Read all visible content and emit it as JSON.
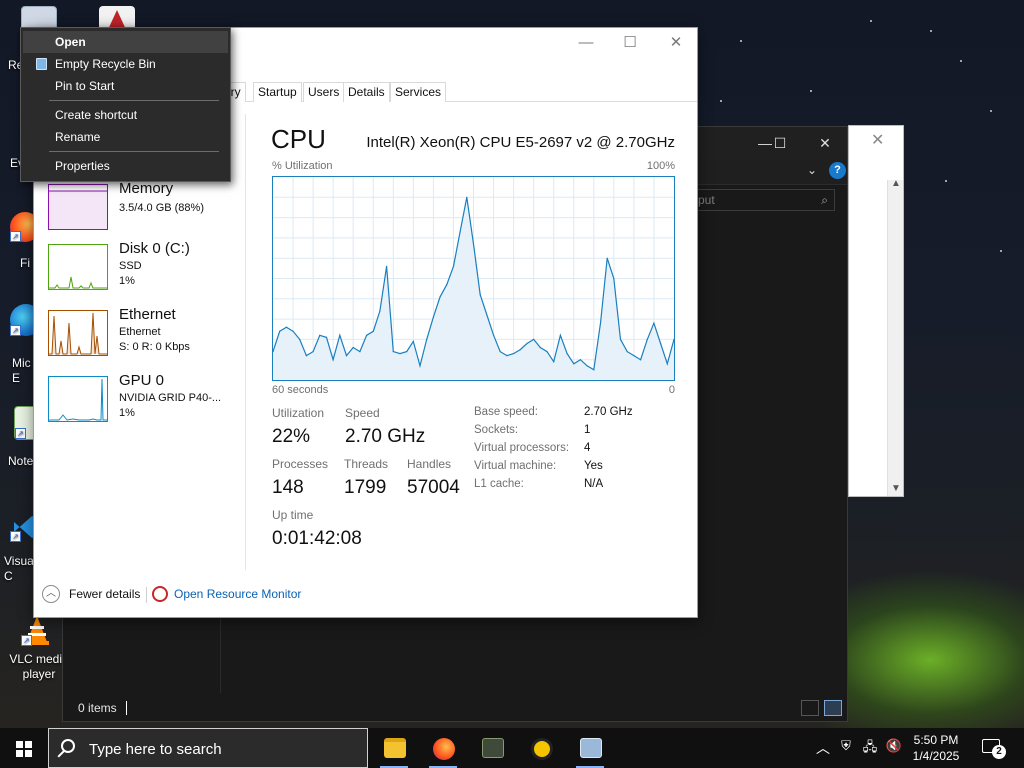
{
  "desktop": {
    "icons": [
      {
        "label": "Re"
      },
      {
        "label": ""
      },
      {
        "label": "Ev"
      },
      {
        "label": "Fi"
      },
      {
        "label": "Mic\nE"
      },
      {
        "label": "Note"
      },
      {
        "label": "Visua\nC"
      },
      {
        "label": "VLC media player"
      }
    ]
  },
  "context_menu": {
    "items": [
      {
        "label": "Open",
        "bold": true
      },
      {
        "label": "Empty Recycle Bin"
      },
      {
        "label": "Pin to Start"
      },
      {
        "label": "Create shortcut"
      },
      {
        "label": "Rename"
      },
      {
        "label": "Properties"
      }
    ]
  },
  "task_manager": {
    "controls": {
      "minimize": "—",
      "maximize": "☐",
      "close": "✕"
    },
    "tabs": [
      {
        "label": "ory"
      },
      {
        "label": "Startup"
      },
      {
        "label": "Users"
      },
      {
        "label": "Details"
      },
      {
        "label": "Services"
      }
    ],
    "sidebar": [
      {
        "title": "Memory",
        "line1": "3.5/4.0 GB (88%)",
        "line2": "",
        "color": "#8b12ae"
      },
      {
        "title": "Disk 0 (C:)",
        "line1": "SSD",
        "line2": "1%",
        "color": "#4da60c"
      },
      {
        "title": "Ethernet",
        "line1": "Ethernet",
        "line2": "S: 0 R: 0 Kbps",
        "color": "#a74f01"
      },
      {
        "title": "GPU 0",
        "line1": "NVIDIA GRID P40-...",
        "line2": "1%",
        "color": "#0e8ac9"
      }
    ],
    "cpu": {
      "title": "CPU",
      "model": "Intel(R) Xeon(R) CPU E5-2697 v2 @ 2.70GHz",
      "util_label": "% Utilization",
      "util_max": "100%",
      "axis_left": "60 seconds",
      "axis_right": "0",
      "stats": {
        "utilization_label": "Utilization",
        "utilization": "22%",
        "speed_label": "Speed",
        "speed": "2.70 GHz",
        "processes_label": "Processes",
        "processes": "148",
        "threads_label": "Threads",
        "threads": "1799",
        "handles_label": "Handles",
        "handles": "57004",
        "uptime_label": "Up time",
        "uptime": "0:01:42:08"
      },
      "specs": [
        {
          "label": "Base speed:",
          "value": "2.70 GHz"
        },
        {
          "label": "Sockets:",
          "value": "1"
        },
        {
          "label": "Virtual processors:",
          "value": "4"
        },
        {
          "label": "Virtual machine:",
          "value": "Yes"
        },
        {
          "label": "L1 cache:",
          "value": "N/A"
        }
      ]
    },
    "footer": {
      "fewer_details": "Fewer details",
      "open_resource_monitor": "Open Resource Monitor"
    }
  },
  "chart_data": {
    "type": "area",
    "title": "CPU",
    "ylabel": "% Utilization",
    "xlabel": "60 seconds",
    "ylim": [
      0,
      100
    ],
    "x": [
      60,
      59,
      58,
      57,
      56,
      55,
      54,
      53,
      52,
      51,
      50,
      49,
      48,
      47,
      46,
      45,
      44,
      43,
      42,
      41,
      40,
      39,
      38,
      37,
      36,
      35,
      34,
      33,
      32,
      31,
      30,
      29,
      28,
      27,
      26,
      25,
      24,
      23,
      22,
      21,
      20,
      19,
      18,
      17,
      16,
      15,
      14,
      13,
      12,
      11,
      10,
      9,
      8,
      7,
      6,
      5,
      4,
      3,
      2,
      1,
      0
    ],
    "series": [
      {
        "values": [
          14,
          24,
          26,
          24,
          20,
          12,
          14,
          22,
          21,
          10,
          22,
          12,
          16,
          14,
          22,
          24,
          34,
          56,
          14,
          13,
          14,
          19,
          7,
          20,
          31,
          41,
          47,
          56,
          73,
          90,
          67,
          42,
          32,
          22,
          14,
          12,
          13,
          15,
          18,
          20,
          16,
          14,
          9,
          22,
          13,
          8,
          10,
          7,
          5,
          28,
          60,
          50,
          20,
          14,
          12,
          10,
          20,
          28,
          18,
          8,
          20
        ]
      }
    ],
    "grid": true,
    "line_color": "#1a7fbf",
    "fill_color": "#e6f1fa"
  },
  "explorer": {
    "search_placeholder": "put",
    "status": "0 items"
  },
  "taskbar": {
    "search_placeholder": "Type here to search",
    "time": "5:50 PM",
    "date": "1/4/2025",
    "notification_count": "2",
    "apps": [
      {
        "name": "file-explorer",
        "color": "#f2c230"
      },
      {
        "name": "firefox",
        "color": "#ff7a1a"
      },
      {
        "name": "game-app",
        "color": "#3f4a3a"
      },
      {
        "name": "app-yellow",
        "color": "#f4c400"
      },
      {
        "name": "window-app",
        "color": "#9ab8d8"
      }
    ]
  },
  "colors": {
    "accent": "#1a7fbf",
    "link": "#0a62b5"
  }
}
